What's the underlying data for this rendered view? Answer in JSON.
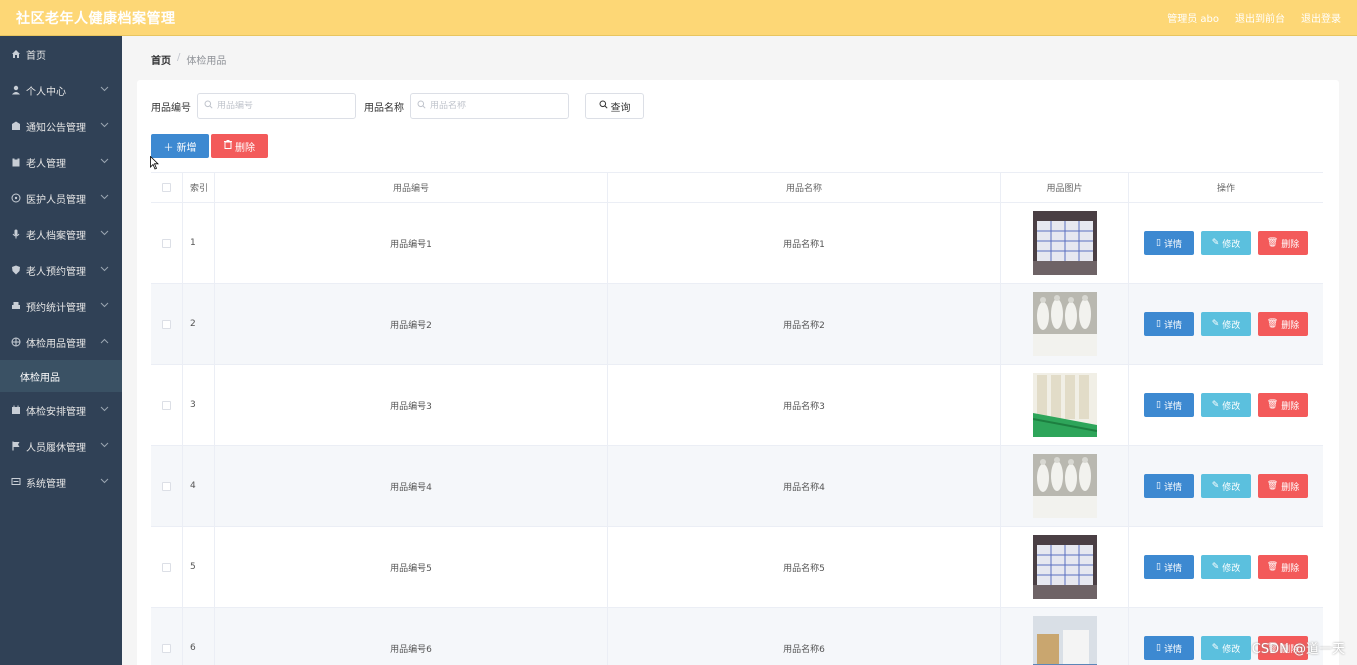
{
  "header": {
    "title": "社区老年人健康档案管理",
    "admin_label": "管理员 abo",
    "back_home": "退出到前台",
    "logout": "退出登录"
  },
  "sidebar": {
    "items": [
      {
        "label": "首页",
        "icon": "home-icon"
      },
      {
        "label": "个人中心",
        "icon": "user-icon"
      },
      {
        "label": "通知公告管理",
        "icon": "notice-icon"
      },
      {
        "label": "老人管理",
        "icon": "clipboard-icon"
      },
      {
        "label": "医护人员管理",
        "icon": "medical-icon"
      },
      {
        "label": "老人档案管理",
        "icon": "mic-icon"
      },
      {
        "label": "老人预约管理",
        "icon": "shield-icon"
      },
      {
        "label": "预约统计管理",
        "icon": "printer-icon"
      },
      {
        "label": "体检用品管理",
        "icon": "aperture-icon"
      },
      {
        "label": "体检安排管理",
        "icon": "calendar-icon"
      },
      {
        "label": "人员履休管理",
        "icon": "flag-icon"
      },
      {
        "label": "系统管理",
        "icon": "chat-icon"
      }
    ],
    "active_sub": "体检用品"
  },
  "breadcrumb": {
    "home": "首页",
    "separator": "/",
    "current": "体检用品"
  },
  "search": {
    "code_label": "用品编号",
    "code_placeholder": "用品编号",
    "name_label": "用品名称",
    "name_placeholder": "用品名称",
    "query_button": "查询"
  },
  "actions": {
    "add": "新增",
    "delete": "删除"
  },
  "table": {
    "headers": {
      "index": "索引",
      "code": "用品编号",
      "name": "用品名称",
      "image": "用品图片",
      "ops": "操作"
    },
    "rows": [
      {
        "index": "1",
        "code": "用品编号1",
        "name": "用品名称1"
      },
      {
        "index": "2",
        "code": "用品编号2",
        "name": "用品名称2"
      },
      {
        "index": "3",
        "code": "用品编号3",
        "name": "用品名称3"
      },
      {
        "index": "4",
        "code": "用品编号4",
        "name": "用品名称4"
      },
      {
        "index": "5",
        "code": "用品编号5",
        "name": "用品名称5"
      },
      {
        "index": "6",
        "code": "用品编号6",
        "name": "用品名称6"
      }
    ],
    "op_labels": {
      "detail": "详情",
      "edit": "修改",
      "delete": "删除"
    }
  },
  "watermark": "CSDN @道一天",
  "colors": {
    "topbar": "#fdd776",
    "sidebar": "#304156",
    "primary": "#3d89d1",
    "info": "#5bc0de",
    "danger": "#f35a5a"
  }
}
